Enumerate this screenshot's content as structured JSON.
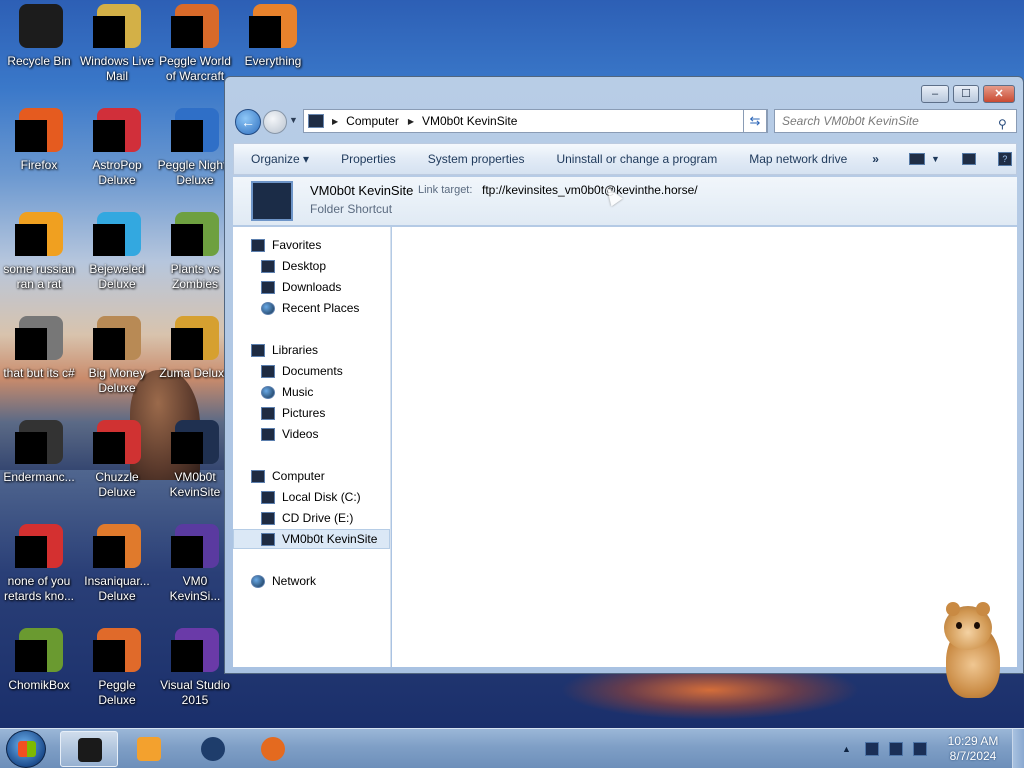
{
  "desktop": {
    "icons": [
      {
        "label": "Recycle Bin",
        "icon": "recycle-bin-icon",
        "color": "#1c1c1c"
      },
      {
        "label": "Windows Live Mail",
        "icon": "windows-live-mail-icon",
        "color": "#d3b047"
      },
      {
        "label": "Peggle World of Warcraft",
        "icon": "peggle-icon",
        "color": "#d86a2a"
      },
      {
        "label": "Everything",
        "icon": "everything-icon",
        "color": "#e8822c"
      },
      {
        "label": "Firefox",
        "icon": "firefox-icon",
        "color": "#e55b1f"
      },
      {
        "label": "AstroPop Deluxe",
        "icon": "astropop-icon",
        "color": "#d12f3a"
      },
      {
        "label": "Peggle Nights Deluxe",
        "icon": "peggle-nights-icon",
        "color": "#2f6fc7"
      },
      {
        "label": "some russian ran a rat",
        "icon": "file-icon",
        "color": "#f0a020"
      },
      {
        "label": "Bejeweled Deluxe",
        "icon": "bejeweled-icon",
        "color": "#33a8e0"
      },
      {
        "label": "Plants vs Zombies",
        "icon": "plants-vs-zombies-icon",
        "color": "#6ea040"
      },
      {
        "label": "that but its c#",
        "icon": "shortcut-icon",
        "color": "#777777"
      },
      {
        "label": "Big Money Deluxe",
        "icon": "big-money-icon",
        "color": "#b88a55"
      },
      {
        "label": "Zuma Deluxe",
        "icon": "zuma-icon",
        "color": "#d6a030"
      },
      {
        "label": "Endermanc...",
        "icon": "app-icon",
        "color": "#333333"
      },
      {
        "label": "Chuzzle Deluxe",
        "icon": "chuzzle-icon",
        "color": "#d03232"
      },
      {
        "label": "VM0b0t KevinSite",
        "icon": "folder-shortcut-icon",
        "color": "#1f3050"
      },
      {
        "label": "none of you retards kno...",
        "icon": "app-icon",
        "color": "#d43030"
      },
      {
        "label": "Insaniquar... Deluxe",
        "icon": "insaniquarium-icon",
        "color": "#e07a2c"
      },
      {
        "label": "VM0 KevinSi...",
        "icon": "shortcut-icon",
        "color": "#5a3aa0"
      },
      {
        "label": "ChomikBox",
        "icon": "chomikbox-icon",
        "color": "#6a9a30"
      },
      {
        "label": "Peggle Deluxe",
        "icon": "peggle-deluxe-icon",
        "color": "#e06a2a"
      },
      {
        "label": "Visual Studio 2015",
        "icon": "visual-studio-icon",
        "color": "#6a3aa8"
      }
    ]
  },
  "window": {
    "controls": {
      "minimize": "‒",
      "maximize": "☐",
      "close": "✕"
    },
    "address": {
      "root": "Computer",
      "current": "VM0b0t KevinSite"
    },
    "search_placeholder": "Search VM0b0t KevinSite",
    "commands": [
      "Organize ▾",
      "Properties",
      "System properties",
      "Uninstall or change a program",
      "Map network drive",
      "»"
    ],
    "details": {
      "name": "VM0b0t KevinSite",
      "link_label": "Link target:",
      "link_value": "ftp://kevinsites_vm0b0t@kevinthe.horse/",
      "type": "Folder Shortcut"
    },
    "nav": {
      "favorites": "Favorites",
      "desktop": "Desktop",
      "downloads": "Downloads",
      "recent": "Recent Places",
      "libraries": "Libraries",
      "documents": "Documents",
      "music": "Music",
      "pictures": "Pictures",
      "videos": "Videos",
      "computer": "Computer",
      "local_disk": "Local Disk (C:)",
      "cd_drive": "CD Drive (E:)",
      "kevinsite": "VM0b0t KevinSite",
      "network": "Network"
    }
  },
  "taskbar": {
    "time": "10:29 AM",
    "date": "8/7/2024"
  }
}
